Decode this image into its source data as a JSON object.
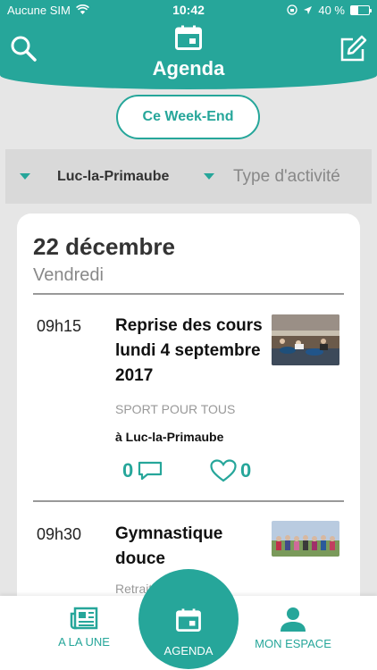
{
  "status_bar": {
    "carrier": "Aucune SIM",
    "time": "10:42",
    "battery": "40 %",
    "battery_level": 0.4
  },
  "header": {
    "title": "Agenda"
  },
  "quick_filter": {
    "label": "Ce Week-End"
  },
  "filters": {
    "location": "Luc-la-Primaube",
    "type_placeholder": "Type d'activité"
  },
  "day": {
    "date": "22 décembre",
    "weekday": "Vendredi"
  },
  "events": [
    {
      "time": "09h15",
      "title": "Reprise des cours lundi 4 septembre 2017",
      "category": "SPORT POUR TOUS",
      "location": "à Luc-la-Primaube",
      "comments": "0",
      "likes": "0"
    },
    {
      "time": "09h30",
      "title": "Gymnastique douce",
      "category": "Retraite"
    }
  ],
  "nav": {
    "news": "A LA UNE",
    "agenda": "AGENDA",
    "account": "MON ESPACE"
  },
  "colors": {
    "accent": "#26a69a",
    "background": "#e6e6e6"
  }
}
